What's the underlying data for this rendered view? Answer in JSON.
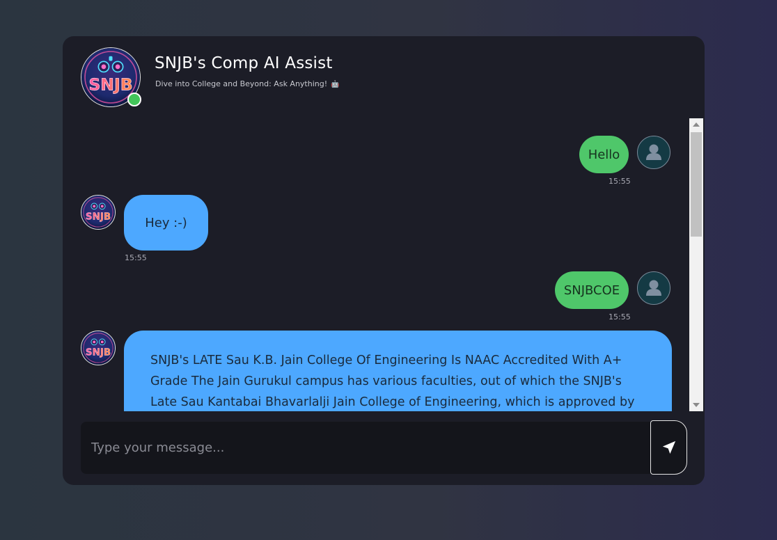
{
  "header": {
    "title": "SNJB's Comp AI Assist",
    "subtitle": "Dive into College and Beyond: Ask Anything!",
    "subtitle_emoji": "🤖",
    "logo_text": "SNJB",
    "status": "online"
  },
  "messages": [
    {
      "sender": "user",
      "text": "Hello",
      "time": "15:55"
    },
    {
      "sender": "bot",
      "text": "Hey :-)",
      "time": "15:55"
    },
    {
      "sender": "user",
      "text": "SNJBCOE",
      "time": "15:55"
    },
    {
      "sender": "bot",
      "text": "SNJB's LATE Sau K.B. Jain College Of Engineering Is NAAC Accredited With A+ Grade The Jain Gurukul campus has various faculties, out of which the SNJB's Late Sau Kantabai Bhavarlalji Jain College of Engineering, which is approved by the All",
      "time": ""
    }
  ],
  "composer": {
    "placeholder": "Type your message...",
    "value": ""
  },
  "icons": {
    "send": "send-icon",
    "user_avatar": "user-avatar-icon"
  },
  "colors": {
    "user_bubble": "#4fc76a",
    "bot_bubble": "#4da8ff",
    "card_bg": "#1c1d27",
    "online": "#43c55a"
  }
}
